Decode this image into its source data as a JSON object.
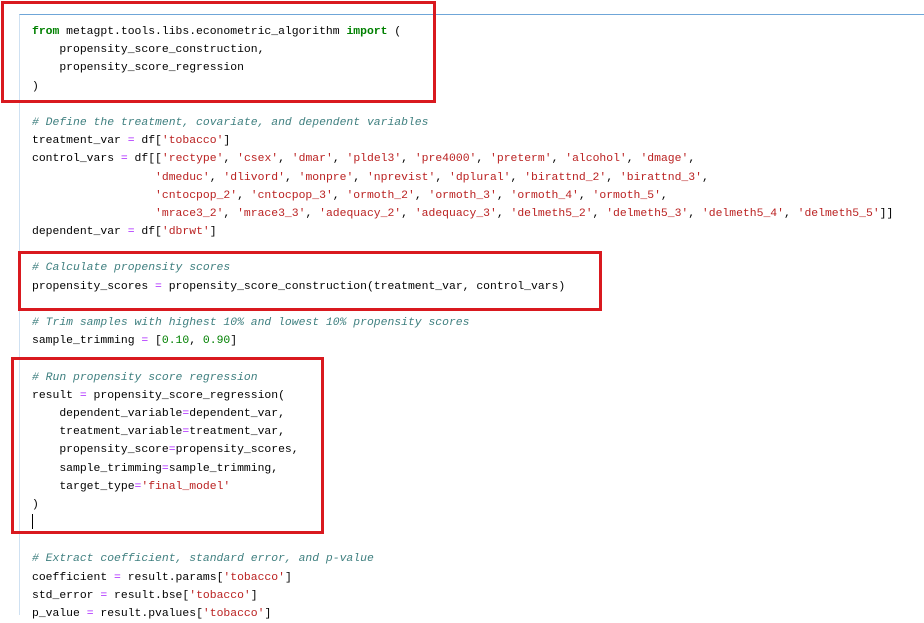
{
  "colors": {
    "keyword": "#008000",
    "string": "#ba2121",
    "comment": "#408080",
    "operator": "#aa22ff",
    "highlight_box": "#d9191f",
    "cell_border": "#6fa6d8"
  },
  "code_lines": [
    [
      {
        "t": "from",
        "c": "kw"
      },
      {
        "t": " metagpt.tools.libs.econometric_algorithm ",
        "c": "id"
      },
      {
        "t": "import",
        "c": "kw"
      },
      {
        "t": " (",
        "c": "id"
      }
    ],
    [
      {
        "t": "    propensity_score_construction,",
        "c": "id"
      }
    ],
    [
      {
        "t": "    propensity_score_regression",
        "c": "id"
      }
    ],
    [
      {
        "t": ")",
        "c": "id"
      }
    ],
    [],
    [
      {
        "t": "# Define the treatment, covariate, and dependent variables",
        "c": "cm"
      }
    ],
    [
      {
        "t": "treatment_var ",
        "c": "id"
      },
      {
        "t": "=",
        "c": "op"
      },
      {
        "t": " df[",
        "c": "id"
      },
      {
        "t": "'tobacco'",
        "c": "str"
      },
      {
        "t": "]",
        "c": "id"
      }
    ],
    [
      {
        "t": "control_vars ",
        "c": "id"
      },
      {
        "t": "=",
        "c": "op"
      },
      {
        "t": " df[[",
        "c": "id"
      },
      {
        "t": "'rectype'",
        "c": "str"
      },
      {
        "t": ", ",
        "c": "id"
      },
      {
        "t": "'csex'",
        "c": "str"
      },
      {
        "t": ", ",
        "c": "id"
      },
      {
        "t": "'dmar'",
        "c": "str"
      },
      {
        "t": ", ",
        "c": "id"
      },
      {
        "t": "'pldel3'",
        "c": "str"
      },
      {
        "t": ", ",
        "c": "id"
      },
      {
        "t": "'pre4000'",
        "c": "str"
      },
      {
        "t": ", ",
        "c": "id"
      },
      {
        "t": "'preterm'",
        "c": "str"
      },
      {
        "t": ", ",
        "c": "id"
      },
      {
        "t": "'alcohol'",
        "c": "str"
      },
      {
        "t": ", ",
        "c": "id"
      },
      {
        "t": "'dmage'",
        "c": "str"
      },
      {
        "t": ",",
        "c": "id"
      }
    ],
    [
      {
        "t": "                  ",
        "c": "id"
      },
      {
        "t": "'dmeduc'",
        "c": "str"
      },
      {
        "t": ", ",
        "c": "id"
      },
      {
        "t": "'dlivord'",
        "c": "str"
      },
      {
        "t": ", ",
        "c": "id"
      },
      {
        "t": "'monpre'",
        "c": "str"
      },
      {
        "t": ", ",
        "c": "id"
      },
      {
        "t": "'nprevist'",
        "c": "str"
      },
      {
        "t": ", ",
        "c": "id"
      },
      {
        "t": "'dplural'",
        "c": "str"
      },
      {
        "t": ", ",
        "c": "id"
      },
      {
        "t": "'birattnd_2'",
        "c": "str"
      },
      {
        "t": ", ",
        "c": "id"
      },
      {
        "t": "'birattnd_3'",
        "c": "str"
      },
      {
        "t": ",",
        "c": "id"
      }
    ],
    [
      {
        "t": "                  ",
        "c": "id"
      },
      {
        "t": "'cntocpop_2'",
        "c": "str"
      },
      {
        "t": ", ",
        "c": "id"
      },
      {
        "t": "'cntocpop_3'",
        "c": "str"
      },
      {
        "t": ", ",
        "c": "id"
      },
      {
        "t": "'ormoth_2'",
        "c": "str"
      },
      {
        "t": ", ",
        "c": "id"
      },
      {
        "t": "'ormoth_3'",
        "c": "str"
      },
      {
        "t": ", ",
        "c": "id"
      },
      {
        "t": "'ormoth_4'",
        "c": "str"
      },
      {
        "t": ", ",
        "c": "id"
      },
      {
        "t": "'ormoth_5'",
        "c": "str"
      },
      {
        "t": ",",
        "c": "id"
      }
    ],
    [
      {
        "t": "                  ",
        "c": "id"
      },
      {
        "t": "'mrace3_2'",
        "c": "str"
      },
      {
        "t": ", ",
        "c": "id"
      },
      {
        "t": "'mrace3_3'",
        "c": "str"
      },
      {
        "t": ", ",
        "c": "id"
      },
      {
        "t": "'adequacy_2'",
        "c": "str"
      },
      {
        "t": ", ",
        "c": "id"
      },
      {
        "t": "'adequacy_3'",
        "c": "str"
      },
      {
        "t": ", ",
        "c": "id"
      },
      {
        "t": "'delmeth5_2'",
        "c": "str"
      },
      {
        "t": ", ",
        "c": "id"
      },
      {
        "t": "'delmeth5_3'",
        "c": "str"
      },
      {
        "t": ", ",
        "c": "id"
      },
      {
        "t": "'delmeth5_4'",
        "c": "str"
      },
      {
        "t": ", ",
        "c": "id"
      },
      {
        "t": "'delmeth5_5'",
        "c": "str"
      },
      {
        "t": "]]",
        "c": "id"
      }
    ],
    [
      {
        "t": "dependent_var ",
        "c": "id"
      },
      {
        "t": "=",
        "c": "op"
      },
      {
        "t": " df[",
        "c": "id"
      },
      {
        "t": "'dbrwt'",
        "c": "str"
      },
      {
        "t": "]",
        "c": "id"
      }
    ],
    [],
    [
      {
        "t": "# Calculate propensity scores",
        "c": "cm"
      }
    ],
    [
      {
        "t": "propensity_scores ",
        "c": "id"
      },
      {
        "t": "=",
        "c": "op"
      },
      {
        "t": " propensity_score_construction(treatment_var, control_vars)",
        "c": "id"
      }
    ],
    [],
    [
      {
        "t": "# Trim samples with highest 10% and lowest 10% propensity scores",
        "c": "cm"
      }
    ],
    [
      {
        "t": "sample_trimming ",
        "c": "id"
      },
      {
        "t": "=",
        "c": "op"
      },
      {
        "t": " [",
        "c": "id"
      },
      {
        "t": "0.10",
        "c": "num"
      },
      {
        "t": ", ",
        "c": "id"
      },
      {
        "t": "0.90",
        "c": "num"
      },
      {
        "t": "]",
        "c": "id"
      }
    ],
    [],
    [
      {
        "t": "# Run propensity score regression",
        "c": "cm"
      }
    ],
    [
      {
        "t": "result ",
        "c": "id"
      },
      {
        "t": "=",
        "c": "op"
      },
      {
        "t": " propensity_score_regression(",
        "c": "id"
      }
    ],
    [
      {
        "t": "    dependent_variable",
        "c": "id"
      },
      {
        "t": "=",
        "c": "op"
      },
      {
        "t": "dependent_var,",
        "c": "id"
      }
    ],
    [
      {
        "t": "    treatment_variable",
        "c": "id"
      },
      {
        "t": "=",
        "c": "op"
      },
      {
        "t": "treatment_var,",
        "c": "id"
      }
    ],
    [
      {
        "t": "    propensity_score",
        "c": "id"
      },
      {
        "t": "=",
        "c": "op"
      },
      {
        "t": "propensity_scores,",
        "c": "id"
      }
    ],
    [
      {
        "t": "    sample_trimming",
        "c": "id"
      },
      {
        "t": "=",
        "c": "op"
      },
      {
        "t": "sample_trimming,",
        "c": "id"
      }
    ],
    [
      {
        "t": "    target_type",
        "c": "id"
      },
      {
        "t": "=",
        "c": "op"
      },
      {
        "t": "'final_model'",
        "c": "str"
      }
    ],
    [
      {
        "t": ")",
        "c": "id"
      }
    ],
    [
      {
        "t": "",
        "c": "cursor"
      }
    ],
    [],
    [
      {
        "t": "# Extract coefficient, standard error, and p-value",
        "c": "cm"
      }
    ],
    [
      {
        "t": "coefficient ",
        "c": "id"
      },
      {
        "t": "=",
        "c": "op"
      },
      {
        "t": " result.params[",
        "c": "id"
      },
      {
        "t": "'tobacco'",
        "c": "str"
      },
      {
        "t": "]",
        "c": "id"
      }
    ],
    [
      {
        "t": "std_error ",
        "c": "id"
      },
      {
        "t": "=",
        "c": "op"
      },
      {
        "t": " result.bse[",
        "c": "id"
      },
      {
        "t": "'tobacco'",
        "c": "str"
      },
      {
        "t": "]",
        "c": "id"
      }
    ],
    [
      {
        "t": "p_value ",
        "c": "id"
      },
      {
        "t": "=",
        "c": "op"
      },
      {
        "t": " result.pvalues[",
        "c": "id"
      },
      {
        "t": "'tobacco'",
        "c": "str"
      },
      {
        "t": "]",
        "c": "id"
      }
    ]
  ]
}
